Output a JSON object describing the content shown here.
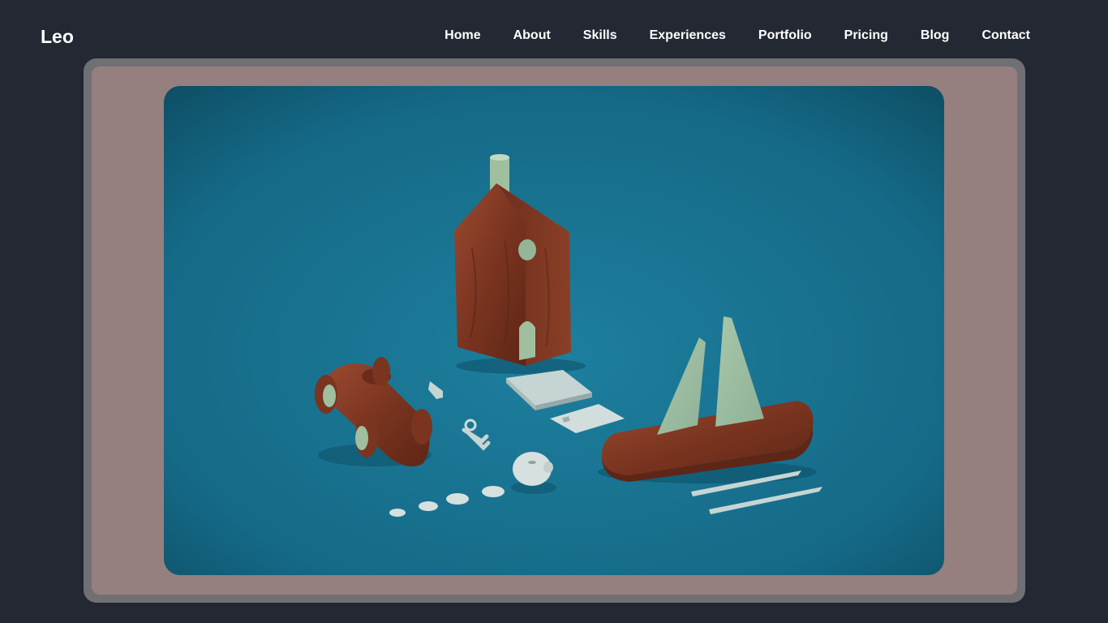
{
  "brand": {
    "name": "Leo"
  },
  "nav": {
    "items": [
      {
        "label": "Home"
      },
      {
        "label": "About"
      },
      {
        "label": "Skills"
      },
      {
        "label": "Experiences"
      },
      {
        "label": "Portfolio"
      },
      {
        "label": "Pricing"
      },
      {
        "label": "Blog"
      },
      {
        "label": "Contact"
      }
    ]
  },
  "colors": {
    "page_background": "#232833",
    "frame_outer": "#707074",
    "frame_inner": "#967f7f",
    "image_backdrop": "#1a6f8f",
    "nav_text": "#ffffff"
  },
  "hero": {
    "image_subject": "wooden toys on teal background"
  }
}
